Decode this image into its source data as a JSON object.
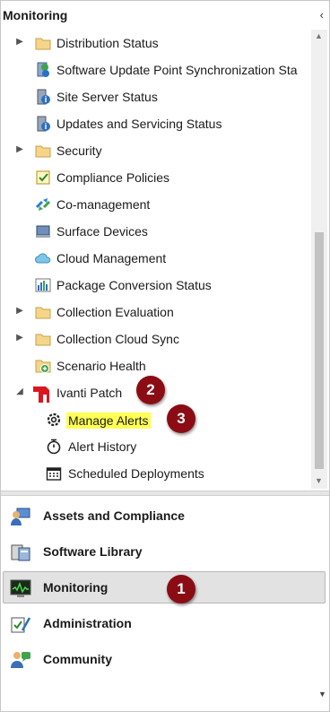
{
  "header": {
    "title": "Monitoring",
    "collapse_glyph": "‹"
  },
  "tree": {
    "items": [
      {
        "label": "Distribution Status",
        "icon": "folder-icon",
        "expandable": true
      },
      {
        "label": "Software Update Point Synchronization Sta",
        "icon": "sync-status-icon",
        "expandable": false
      },
      {
        "label": "Site Server Status",
        "icon": "server-status-icon",
        "expandable": false
      },
      {
        "label": "Updates and Servicing Status",
        "icon": "server-status-icon",
        "expandable": false
      },
      {
        "label": "Security",
        "icon": "folder-icon",
        "expandable": true
      },
      {
        "label": "Compliance Policies",
        "icon": "compliance-icon",
        "expandable": false
      },
      {
        "label": "Co-management",
        "icon": "co-management-icon",
        "expandable": false
      },
      {
        "label": "Surface Devices",
        "icon": "surface-device-icon",
        "expandable": false
      },
      {
        "label": "Cloud Management",
        "icon": "cloud-icon",
        "expandable": false
      },
      {
        "label": "Package Conversion Status",
        "icon": "chart-icon",
        "expandable": false
      },
      {
        "label": "Collection Evaluation",
        "icon": "folder-icon",
        "expandable": true
      },
      {
        "label": "Collection Cloud Sync",
        "icon": "folder-icon",
        "expandable": true
      },
      {
        "label": "Scenario Health",
        "icon": "scenario-health-icon",
        "expandable": false
      },
      {
        "label": "Ivanti Patch",
        "icon": "ivanti-logo-icon",
        "expanded": true
      },
      {
        "label": "Manage Alerts",
        "icon": "gear-icon",
        "child": true,
        "highlighted": true
      },
      {
        "label": "Alert History",
        "icon": "stopwatch-icon",
        "child": true
      },
      {
        "label": "Scheduled Deployments",
        "icon": "calendar-icon",
        "child": true
      }
    ],
    "highlight_color": "#ffff55"
  },
  "callouts": {
    "one": "1",
    "two": "2",
    "three": "3",
    "color": "#8b0c14"
  },
  "workspaces": [
    {
      "label": "Assets and Compliance",
      "icon": "assets-compliance-icon"
    },
    {
      "label": "Software Library",
      "icon": "software-library-icon"
    },
    {
      "label": "Monitoring",
      "icon": "monitoring-icon",
      "selected": true
    },
    {
      "label": "Administration",
      "icon": "administration-icon"
    },
    {
      "label": "Community",
      "icon": "community-icon"
    }
  ]
}
